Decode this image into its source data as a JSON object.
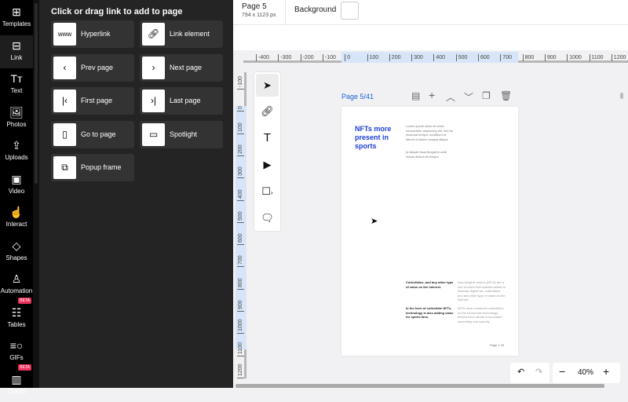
{
  "rail": [
    {
      "label": "Templates",
      "icon": "layout-icon"
    },
    {
      "label": "Link",
      "icon": "link-box-icon",
      "active": true
    },
    {
      "label": "Text",
      "icon": "text-icon"
    },
    {
      "label": "Photos",
      "icon": "photo-icon"
    },
    {
      "label": "Uploads",
      "icon": "upload-icon"
    },
    {
      "label": "Video",
      "icon": "video-icon"
    },
    {
      "label": "Interact",
      "icon": "tap-icon"
    },
    {
      "label": "Shapes",
      "icon": "shapes-icon"
    },
    {
      "label": "Automation",
      "icon": "robot-icon"
    },
    {
      "label": "Tables",
      "icon": "table-icon",
      "badge": "BETA"
    },
    {
      "label": "GIFs",
      "icon": "gif-icon"
    },
    {
      "label": "Charts",
      "icon": "chart-icon",
      "badge": "BETA"
    }
  ],
  "panel": {
    "title": "Click or drag link to add to page",
    "items": [
      {
        "label": "Hyperlink",
        "icon": "www-icon"
      },
      {
        "label": "Link element",
        "icon": "link-icon"
      },
      {
        "label": "Prev page",
        "icon": "prev-page-icon"
      },
      {
        "label": "Next page",
        "icon": "next-page-icon"
      },
      {
        "label": "First page",
        "icon": "first-page-icon"
      },
      {
        "label": "Last page",
        "icon": "last-page-icon"
      },
      {
        "label": "Go to page",
        "icon": "go-to-page-icon"
      },
      {
        "label": "Spotlight",
        "icon": "spotlight-icon"
      },
      {
        "label": "Popup frame",
        "icon": "popup-frame-icon"
      }
    ]
  },
  "header": {
    "page_title": "Page 5",
    "page_size": "794 x 1123 px",
    "background_label": "Background",
    "background_color": "#ffffff"
  },
  "hruler": [
    "-400",
    "-300",
    "-200",
    "-100",
    "0",
    "100",
    "200",
    "300",
    "400",
    "500",
    "600",
    "700",
    "800",
    "900",
    "1000",
    "1100",
    "1200"
  ],
  "vruler": [
    "-100",
    "0",
    "100",
    "200",
    "300",
    "400",
    "500",
    "600",
    "700",
    "800",
    "900",
    "1000",
    "1100",
    "1200"
  ],
  "page_label": "Page 5/41",
  "doc": {
    "title": "NFTs more present in sports",
    "p1": "Lorem ipsum dolor sit amet, consectetur adipiscing elit, sed do eiusmod tempor incididunt ut labore et dolore magna aliqua.",
    "p2": "Id aliquet risus feugiat in ante metus dictum at tempor.",
    "b1": "Collectibles, and any other type of value on the internet.",
    "t1": "Non-fungible tokens (NFTs) are a sort of asset that enables artists to tokenize digital art, collectibles, and any other type of value on the internet.",
    "b2": "In the form of collectible NFTs, technology is also adding value for sports fans.",
    "t2": "NFTs have enhanced collectibles, as the blockchain technology behind them allows for provable ownership and scarcity.",
    "footer": "Page 1 05"
  },
  "zoom": "40%",
  "accent": "#1a5fd6"
}
